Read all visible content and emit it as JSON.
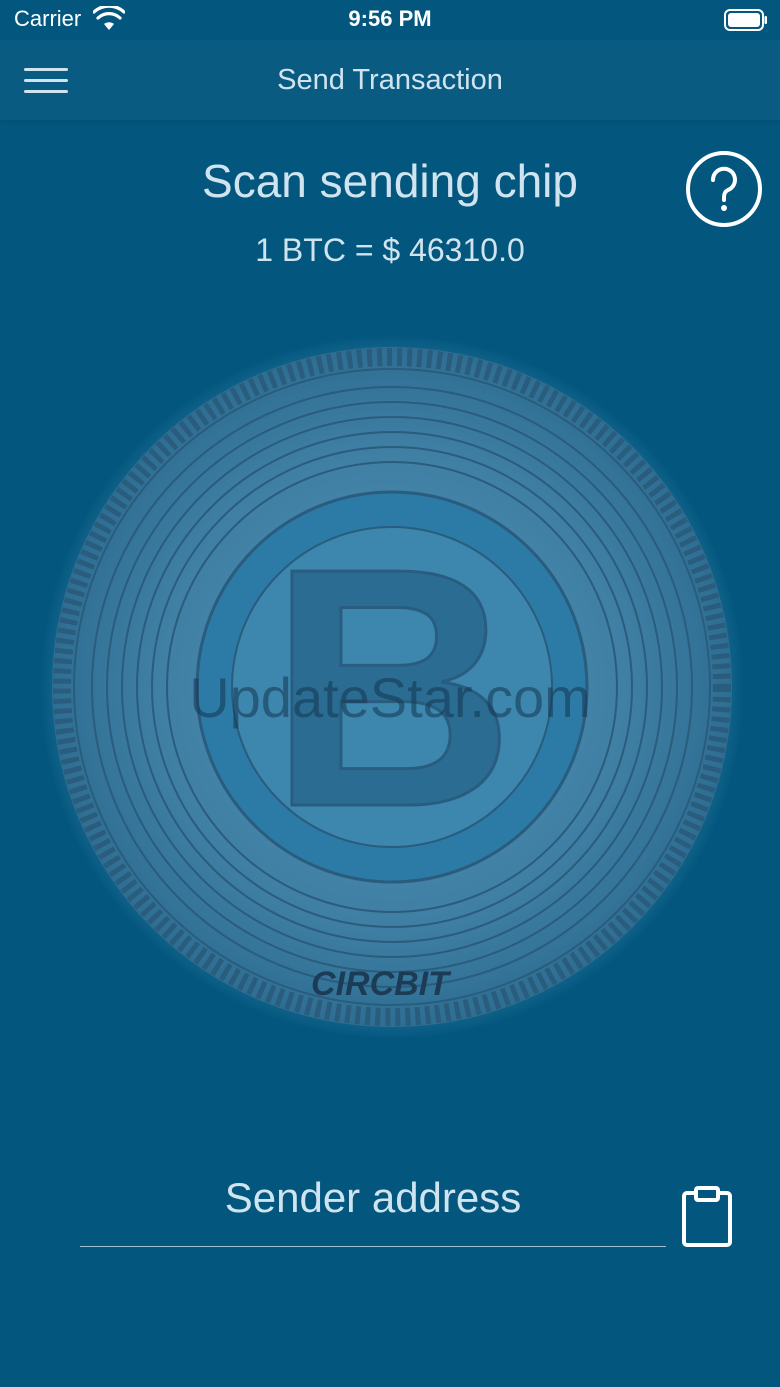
{
  "status_bar": {
    "carrier": "Carrier",
    "time": "9:56 PM",
    "wifi_icon": "wifi-icon",
    "battery_icon": "battery-icon"
  },
  "nav": {
    "title": "Send Transaction",
    "menu_icon": "hamburger-menu-icon"
  },
  "main": {
    "title": "Scan sending chip",
    "rate": "1 BTC = $ 46310.0",
    "help_icon": "question-circle-icon",
    "coin_label": "CIRCBIT",
    "coin_letter": "B",
    "watermark": "UpdateStar.com"
  },
  "form": {
    "address_placeholder": "Sender address",
    "address_value": "",
    "paste_icon": "clipboard-icon"
  },
  "colors": {
    "background": "#03577f",
    "nav_background": "#0a5b82",
    "text": "#cfe4ef",
    "coin_ring": "#1f4f6f"
  }
}
